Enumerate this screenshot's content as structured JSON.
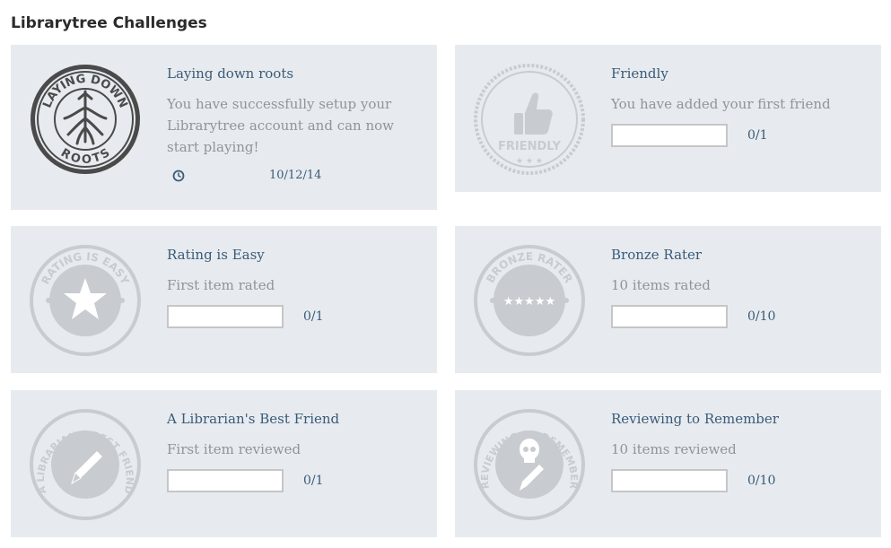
{
  "page": {
    "title": "Librarytree Challenges"
  },
  "colors": {
    "card_bg": "#e7ebef",
    "title": "#3a5a78",
    "desc": "#8f9499",
    "locked_badge": "#c8ccd0",
    "earned_badge": "#444444"
  },
  "challenges": [
    {
      "title": "Laying down roots",
      "description": "You have successfully setup your Librarytree account and can now start playing!",
      "status": "earned",
      "date": "10/12/14",
      "badge_icon": "roots-tree-icon",
      "badge_text_top": "LAYING DOWN",
      "badge_text_bottom": "ROOTS"
    },
    {
      "title": "Friendly",
      "description": "You have added your first friend",
      "status": "locked",
      "progress": "0/1",
      "progress_fraction": 0,
      "badge_icon": "thumbs-up-icon",
      "badge_text": "FRIENDLY"
    },
    {
      "title": "Rating is Easy",
      "description": "First item rated",
      "status": "locked",
      "progress": "0/1",
      "progress_fraction": 0,
      "badge_icon": "star-icon",
      "badge_text": "RATING IS EASY"
    },
    {
      "title": "Bronze Rater",
      "description": "10 items rated",
      "status": "locked",
      "progress": "0/10",
      "progress_fraction": 0,
      "badge_icon": "five-stars-icon",
      "badge_text": "BRONZE RATER"
    },
    {
      "title": "A Librarian's Best Friend",
      "description": "First item reviewed",
      "status": "locked",
      "progress": "0/1",
      "progress_fraction": 0,
      "badge_icon": "pencil-icon",
      "badge_text": "A LIBRARIAN'S BEST FRIEND"
    },
    {
      "title": "Reviewing to Remember",
      "description": "10 items reviewed",
      "status": "locked",
      "progress": "0/10",
      "progress_fraction": 0,
      "badge_icon": "skull-pencil-icon",
      "badge_text": "REVIEWING TO REMEMBER"
    }
  ]
}
